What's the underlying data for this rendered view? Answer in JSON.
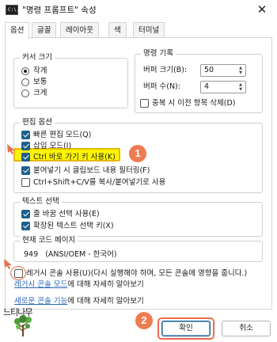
{
  "window": {
    "title": "\"명령 프롬프트\" 속성",
    "app_icon_text": "C:\\.",
    "close_symbol": "✕"
  },
  "tabs": [
    {
      "label": "옵션",
      "active": true
    },
    {
      "label": "글꼴",
      "active": false
    },
    {
      "label": "레이아웃",
      "active": false
    },
    {
      "label": "색",
      "active": false
    },
    {
      "label": "터미널",
      "active": false
    }
  ],
  "cursor_size": {
    "title": "커서 크기",
    "options": [
      {
        "label": "작게",
        "checked": true
      },
      {
        "label": "보통",
        "checked": false
      },
      {
        "label": "크게",
        "checked": false
      }
    ]
  },
  "command_history": {
    "title": "명령 기록",
    "buffer_size_label": "버퍼 크기(B):",
    "buffer_size_value": "50",
    "buffer_count_label": "버퍼 수(N):",
    "buffer_count_value": "4",
    "discard_duplicates_label": "중복 시 이전 항목 삭제(D)",
    "discard_duplicates_checked": false
  },
  "edit_options": {
    "title": "편집 옵션",
    "items": [
      {
        "label": "빠른 편집 모드(Q)",
        "checked": true
      },
      {
        "label": "삽입 모드(I)",
        "checked": true
      },
      {
        "label": "Ctrl 바로 가기 키 사용(K)",
        "checked": true
      },
      {
        "label": "붙여넣기 시 클립보드 내용 필터링(F)",
        "checked": true
      },
      {
        "label": "Ctrl+Shift+C/V를 복사/붙여넣기로 사용",
        "checked": false
      }
    ]
  },
  "text_selection": {
    "title": "텍스트 선택",
    "items": [
      {
        "label": "줄 바꿈 선택 사용(E)",
        "checked": true
      },
      {
        "label": "확장된 텍스트 선택 키(X)",
        "checked": true
      }
    ]
  },
  "code_page": {
    "title": "현재 코드 페이지",
    "value": "949   (ANSI/OEM - 한국어)"
  },
  "legacy": {
    "label": "레거시 콘솔 사용(U)(다시 실행해야 하며, 모든 콘솔에 영향을 줍니다.)",
    "checked": false,
    "link1_anchor": "레거시 콘솔 모드",
    "link1_rest": "에 대해 자세히 알아보기",
    "link2_anchor": "새로운 콘솔 기능",
    "link2_rest": "에 대해 자세히 알아보기"
  },
  "buttons": {
    "ok": "확인",
    "cancel": "취소"
  },
  "annotations": {
    "badge1": "1",
    "badge2": "2"
  },
  "watermark": {
    "text": "느티나무"
  },
  "colors": {
    "accent": "#1f5f8b",
    "highlight": "#fdf500",
    "annotation": "#ef7b51",
    "link": "#2a67b8"
  }
}
